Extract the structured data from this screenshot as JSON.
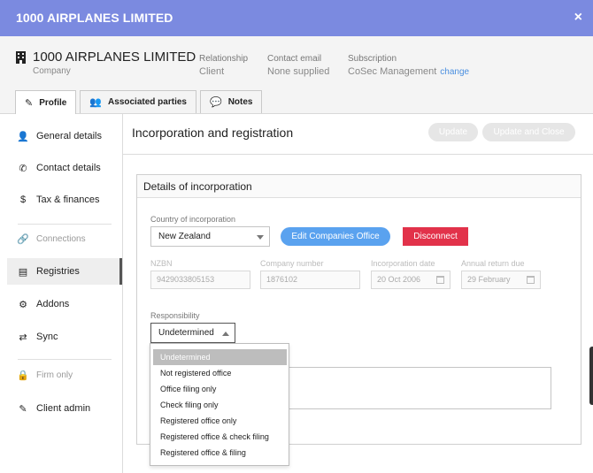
{
  "window": {
    "title": "1000 AIRPLANES LIMITED",
    "close_glyph": "×"
  },
  "header": {
    "company_name": "1000 AIRPLANES LIMITED",
    "company_type": "Company",
    "relationship_label": "Relationship",
    "relationship_value": "Client",
    "contact_label": "Contact email",
    "contact_value": "None supplied",
    "subscription_label": "Subscription",
    "subscription_value": "CoSec Management",
    "subscription_link": "change"
  },
  "tabs": [
    {
      "label": "Profile",
      "icon": "edit-icon",
      "active": true
    },
    {
      "label": "Associated parties",
      "icon": "users-icon",
      "active": false
    },
    {
      "label": "Notes",
      "icon": "comments-icon",
      "active": false
    }
  ],
  "sidebar": {
    "items": [
      {
        "label": "General details",
        "icon": "user-icon"
      },
      {
        "label": "Contact details",
        "icon": "phone-icon"
      },
      {
        "label": "Tax & finances",
        "icon": "hand-coin-icon"
      },
      {
        "label": "Connections",
        "icon": "link-icon"
      },
      {
        "label": "Registries",
        "icon": "registry-icon"
      },
      {
        "label": "Addons",
        "icon": "cog-icon"
      },
      {
        "label": "Sync",
        "icon": "sync-arrows-icon"
      },
      {
        "label": "Firm only",
        "icon": "lock-icon"
      },
      {
        "label": "Client admin",
        "icon": "edit-icon"
      }
    ]
  },
  "main": {
    "title": "Incorporation and registration",
    "update_label": "Update",
    "update_close_label": "Update and Close"
  },
  "panel": {
    "title": "Details of incorporation",
    "country_label": "Country of incorporation",
    "country_value": "New Zealand",
    "edit_office_label": "Edit Companies Office",
    "disconnect_label": "Disconnect",
    "nzbn_label": "NZBN",
    "nzbn_value": "9429033805153",
    "company_number_label": "Company number",
    "company_number_value": "1876102",
    "incorporation_date_label": "Incorporation date",
    "incorporation_date_value": "20 Oct 2006",
    "annual_return_label": "Annual return due",
    "annual_return_value": "29 February",
    "responsibility_label": "Responsibility",
    "responsibility_value": "Undetermined"
  },
  "dropdown": {
    "options": [
      "Undetermined",
      "Not registered office",
      "Office filing only",
      "Check filing only",
      "Registered office only",
      "Registered office & check filing",
      "Registered office & filing"
    ],
    "selected_index": 0
  },
  "colors": {
    "titlebar": "#7b8ae0",
    "primary_button": "#5aa2ef",
    "danger_button": "#e2324a"
  }
}
